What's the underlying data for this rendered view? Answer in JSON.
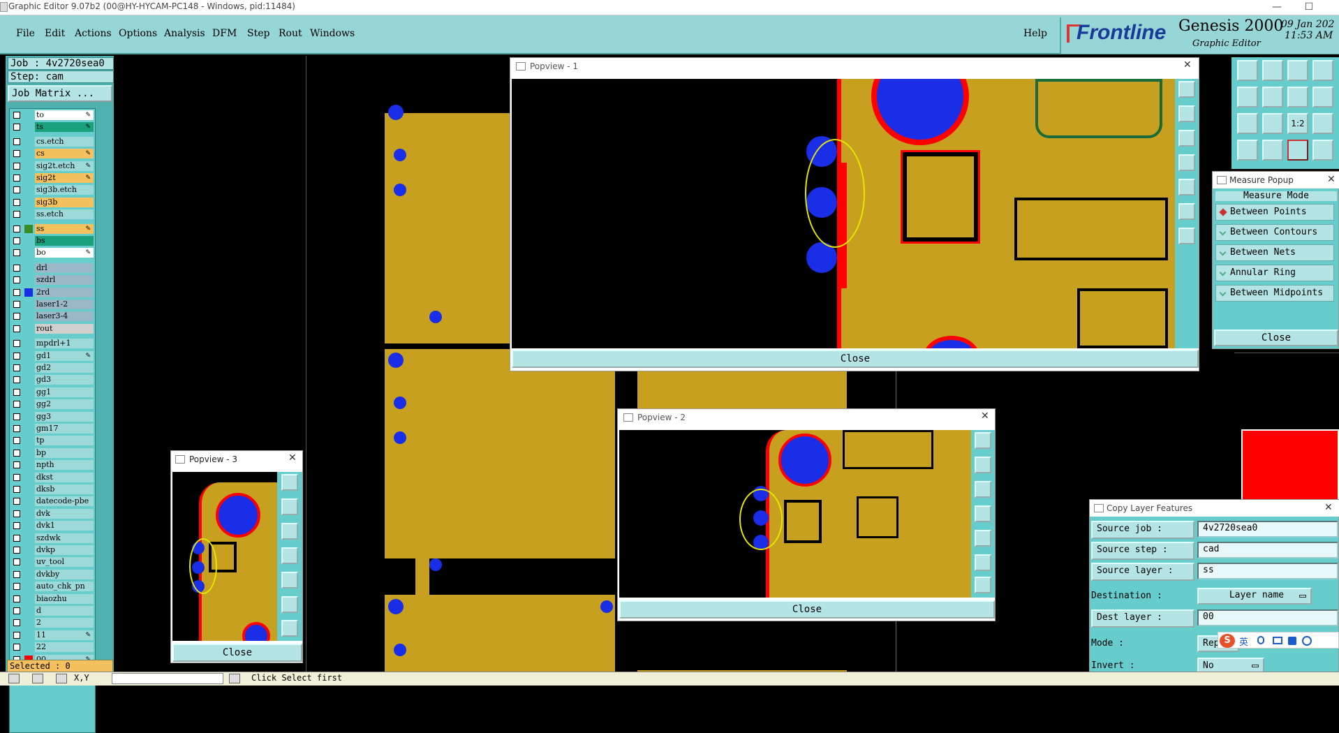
{
  "window": {
    "title": "Graphic Editor 9.07b2 (00@HY-HYCAM-PC148 - Windows, pid:11484)",
    "minimize": "—",
    "maximize": "☐"
  },
  "menu": {
    "items": [
      "File",
      "Edit",
      "Actions",
      "Options",
      "Analysis",
      "DFM",
      "Step",
      "Rout",
      "Windows"
    ],
    "help": "Help"
  },
  "brand": {
    "logo": "Frontline",
    "product": "Genesis 2000",
    "subtitle": "Graphic Editor",
    "date": "09 Jan 202",
    "time": "11:53 AM"
  },
  "job": {
    "job_label": "Job : 4v2720sea0",
    "step_label": "Step: cam",
    "matrix_button": "Job Matrix ..."
  },
  "layers": [
    {
      "name": "to",
      "color": "#ffffff",
      "edit": true
    },
    {
      "name": "ts",
      "color": "#1aa07a",
      "edit": true
    },
    {
      "name": "cs.etch",
      "color": "#9dd9d9",
      "edit": false
    },
    {
      "name": "cs",
      "color": "#f4c15e",
      "edit": true
    },
    {
      "name": "sig2t.etch",
      "color": "#9dd9d9",
      "edit": true
    },
    {
      "name": "sig2t",
      "color": "#f4c15e",
      "edit": true
    },
    {
      "name": "sig3b.etch",
      "color": "#9dd9d9",
      "edit": false
    },
    {
      "name": "sig3b",
      "color": "#f4c15e",
      "edit": false
    },
    {
      "name": "ss.etch",
      "color": "#9dd9d9",
      "edit": false
    },
    {
      "name": "ss",
      "color": "#f4c15e",
      "edit": true
    },
    {
      "name": "bs",
      "color": "#1aa07a",
      "edit": false
    },
    {
      "name": "bo",
      "color": "#ffffff",
      "edit": true
    },
    {
      "name": "drl",
      "color": "#9ab8c8",
      "edit": false
    },
    {
      "name": "szdrl",
      "color": "#9ab8c8",
      "edit": false
    },
    {
      "name": "2rd",
      "color": "#9ab8c8",
      "edit": false
    },
    {
      "name": "laser1-2",
      "color": "#9ab8c8",
      "edit": false
    },
    {
      "name": "laser3-4",
      "color": "#9ab8c8",
      "edit": false
    },
    {
      "name": "rout",
      "color": "#d0d0d0",
      "edit": false
    },
    {
      "name": "mpdrl+1",
      "color": "#9dd9d9",
      "edit": false
    },
    {
      "name": "gd1",
      "color": "#9dd9d9",
      "edit": true
    },
    {
      "name": "gd2",
      "color": "#9dd9d9",
      "edit": false
    },
    {
      "name": "gd3",
      "color": "#9dd9d9",
      "edit": false
    },
    {
      "name": "gg1",
      "color": "#9dd9d9",
      "edit": false
    },
    {
      "name": "gg2",
      "color": "#9dd9d9",
      "edit": false
    },
    {
      "name": "gg3",
      "color": "#9dd9d9",
      "edit": false
    },
    {
      "name": "gm17",
      "color": "#9dd9d9",
      "edit": false
    },
    {
      "name": "tp",
      "color": "#9dd9d9",
      "edit": false
    },
    {
      "name": "bp",
      "color": "#9dd9d9",
      "edit": false
    },
    {
      "name": "npth",
      "color": "#9dd9d9",
      "edit": false
    },
    {
      "name": "dkst",
      "color": "#9dd9d9",
      "edit": false
    },
    {
      "name": "dksb",
      "color": "#9dd9d9",
      "edit": false
    },
    {
      "name": "datecode-pbe",
      "color": "#9dd9d9",
      "edit": false
    },
    {
      "name": "dvk",
      "color": "#9dd9d9",
      "edit": false
    },
    {
      "name": "dvk1",
      "color": "#9dd9d9",
      "edit": false
    },
    {
      "name": "szdwk",
      "color": "#9dd9d9",
      "edit": false
    },
    {
      "name": "dvkp",
      "color": "#9dd9d9",
      "edit": false
    },
    {
      "name": "uv_tool",
      "color": "#9dd9d9",
      "edit": false
    },
    {
      "name": "dvkby",
      "color": "#9dd9d9",
      "edit": false
    },
    {
      "name": "auto_chk_pn",
      "color": "#9dd9d9",
      "edit": false
    },
    {
      "name": "biaozhu",
      "color": "#9dd9d9",
      "edit": false
    },
    {
      "name": "d",
      "color": "#9dd9d9",
      "edit": false
    },
    {
      "name": "2",
      "color": "#9dd9d9",
      "edit": false
    },
    {
      "name": "11",
      "color": "#9dd9d9",
      "edit": true
    },
    {
      "name": "22",
      "color": "#9dd9d9",
      "edit": false
    },
    {
      "name": "00",
      "color": "#9dd9d9",
      "edit": true
    }
  ],
  "selected": "Selected : 0",
  "popview1": {
    "title": "Popview - 1",
    "close": "Close"
  },
  "popview2": {
    "title": "Popview - 2",
    "close": "Close"
  },
  "popview3": {
    "title": "Popview - 3",
    "close": "Close"
  },
  "measure": {
    "title": "Measure Popup",
    "mode_label": "Measure Mode",
    "options": [
      "Between Points",
      "Between Contours",
      "Between Nets",
      "Annular Ring",
      "Between Midpoints"
    ],
    "active": "Between Points",
    "close": "Close"
  },
  "copy_layer": {
    "title": "Copy Layer Features",
    "source_job_label": "Source job   :",
    "source_job": "4v2720sea0",
    "source_step_label": "Source step  :",
    "source_step": "cad",
    "source_layer_label": "Source layer :",
    "source_layer": "ss",
    "destination_label": "Destination  :",
    "destination": "Layer name",
    "dest_layer_label": "Dest  layer  :",
    "dest_layer": "00",
    "mode_label": "Mode         :",
    "mode": "Repl",
    "invert_label": "Invert       :",
    "invert": "No"
  },
  "toolbar_right": {
    "buttons": [
      "1:2"
    ]
  },
  "ime": {
    "label": "英"
  },
  "status": {
    "coord_label": "X,Y",
    "hint": "Click Select first"
  },
  "colors": {
    "teal": "#96d6d6",
    "copper": "#c7a020",
    "pad": "#1a2ee8",
    "clearance": "#ff0000",
    "highlight": "#e6e600"
  }
}
